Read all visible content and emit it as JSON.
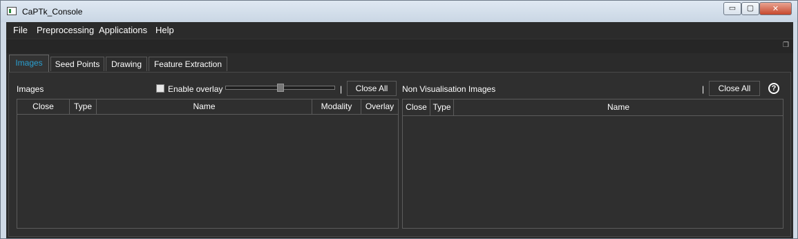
{
  "window": {
    "title": "CaPTk_Console",
    "minimize": "▭",
    "maximize": "▢",
    "close": "✕"
  },
  "menu": [
    "File",
    "Preprocessing",
    "Applications",
    "Help"
  ],
  "tabs": [
    {
      "label": "Images",
      "active": true
    },
    {
      "label": "Seed Points",
      "active": false
    },
    {
      "label": "Drawing",
      "active": false
    },
    {
      "label": "Feature Extraction",
      "active": false
    }
  ],
  "images_panel": {
    "title": "Images",
    "overlay_label": "Enable overlay",
    "overlay_checked": false,
    "overlay_level": 0.5,
    "separator": "|",
    "close_all": "Close All",
    "columns": [
      "Close",
      "Type",
      "Name",
      "Modality",
      "Overlay"
    ]
  },
  "non_vis_panel": {
    "title": "Non Visualisation Images",
    "separator": "|",
    "close_all": "Close All",
    "help": "?",
    "columns": [
      "Close",
      "Type",
      "Name"
    ]
  },
  "colors": {
    "background": "#2b2b2b",
    "active_tab": "#2a9fd0",
    "text": "#ffffff"
  },
  "icons": {
    "app": "captk-app-icon",
    "float": "float-dock-icon",
    "help": "help-circle-icon"
  }
}
